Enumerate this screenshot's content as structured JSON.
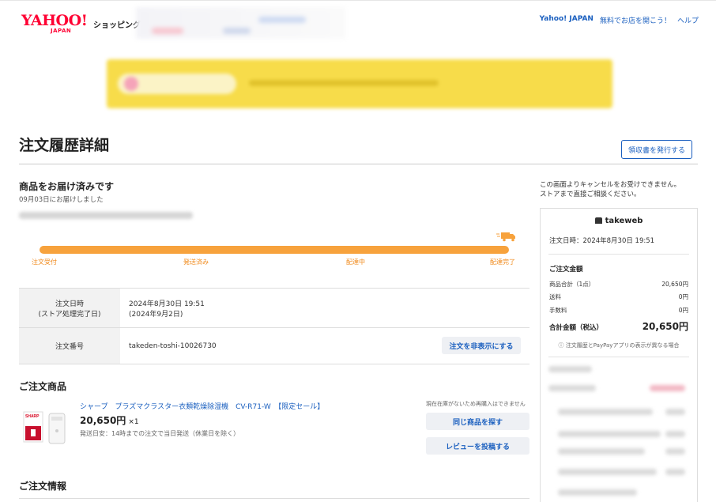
{
  "header": {
    "logo_main": "YAHOO!",
    "logo_sub": "JAPAN",
    "service": "ショッピング",
    "links": [
      "Yahoo! JAPAN",
      "無料でお店を開こう！",
      "ヘルプ"
    ]
  },
  "page": {
    "title": "注文履歴詳細",
    "receipt_button": "領収書を発行する"
  },
  "status": {
    "title": "商品をお届け済みです",
    "subtitle": "09月03日にお届けしました",
    "progress_fraction": 1.0,
    "steps": [
      "注文受付",
      "発送済み",
      "配達中",
      "配達完了"
    ]
  },
  "order_info": {
    "rows": [
      {
        "label_lines": [
          "注文日時",
          "(ストア処理完了日)"
        ],
        "value_lines": [
          "2024年8月30日 19:51",
          "(2024年9月2日)"
        ]
      },
      {
        "label_lines": [
          "注文番号"
        ],
        "value_lines": [
          "takeden-toshi-10026730"
        ]
      }
    ],
    "hide_button": "注文を非表示にする"
  },
  "products": {
    "section_title": "ご注文商品",
    "items": [
      {
        "name": "シャープ　プラズマクラスター衣類乾燥除湿機　CV-R71-W　【限定セール】",
        "price": "20,650円",
        "quantity": "×1",
        "shipping": "発送日安：14時までの注文で当日発送（休業日を除く）",
        "note": "現在在庫がないため再購入はできません",
        "buttons": [
          "同じ商品を探す",
          "レビューを投稿する"
        ]
      }
    ]
  },
  "order_details": {
    "section_title": "ご注文情報"
  },
  "sidebar": {
    "note_lines": [
      "この画面よりキャンセルをお受けできません。",
      "ストアまで直接ご相談ください。"
    ],
    "store_name": "takeweb",
    "order_datetime": "注文日時：2024年8月30日 19:51",
    "summary_title": "ご注文金額",
    "summary_rows": [
      {
        "label": "商品合計（1点）",
        "value": "20,650円"
      },
      {
        "label": "送料",
        "value": "0円"
      },
      {
        "label": "手数料",
        "value": "0円"
      }
    ],
    "total_label": "合計金額（税込）",
    "total_value": "20,650円",
    "paypay_note": "注文履歴とPayPayアプリの表示が異なる場合"
  },
  "colors": {
    "brand_red": "#ff0033",
    "link_blue": "#1a5fbf",
    "progress_orange": "#f7a23c",
    "step_text": "#f08a1c"
  },
  "icons": [
    "truck-icon",
    "store-icon",
    "info-icon"
  ]
}
